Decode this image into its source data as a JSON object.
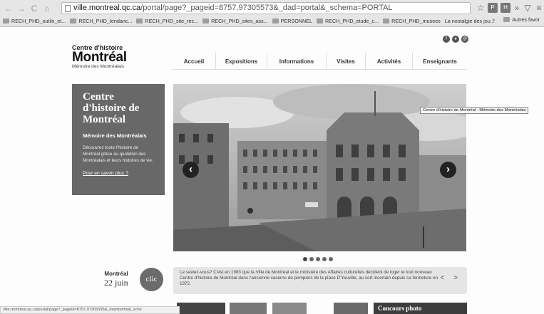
{
  "browser": {
    "url_host": "ville.montreal.qc.ca",
    "url_path": "/portal/page?_pageid=8757,97305573&_dad=portal&_schema=PORTAL",
    "bookmarks": [
      "RECH_PHD_outils_et...",
      "RECH_PHD_tendanc...",
      "RECH_PHD_site_rec...",
      "RECH_PHD_sites_ass...",
      "PERSONNEL",
      "RECH_PHD_etude_c...",
      "RECH_PHD_musees",
      "La nostalgie des jou..."
    ],
    "bookmarks_overflow": "»",
    "other_bookmarks": "Autres favor"
  },
  "site": {
    "logo_line1": "Centre d'histoire",
    "logo_line2": "Montréal",
    "logo_line3": "Mémoire des Montréalais",
    "nav": [
      "Accueil",
      "Expositions",
      "Informations",
      "Visites",
      "Activités",
      "Enseignants"
    ]
  },
  "hero": {
    "title": "Centre d'histoire de Montréal",
    "subtitle": "Mémoire des Montréalais",
    "description": "Découvrez toute l'histoire de Montréal grâce au quotidien des Montréalais et leurs histoires de vie.",
    "more_link": "Pour en savoir plus ?",
    "tooltip": "Centre d'histoire de Montréal - Mémoire des Montréalais",
    "prev_icon": "‹",
    "next_icon": "›"
  },
  "slider": {
    "count": 5,
    "active": 1
  },
  "fact": {
    "city": "Montréal",
    "date": "22 juin",
    "clic_label": "clic",
    "text": "Le saviez-vous? C'est en 1983 que la Ville de Montréal et le ministère des Affaires culturelles décident de loger le tout nouveau Centre d'histoire de Montréal dans l'ancienne caserne de pompiers de la place D'Youville, au sort incertain depuis sa fermeture en 1972.",
    "nav_label": "< >"
  },
  "status_bar": "ville.montreal.qc.ca/portal/page?_pageid=8757,97305595&_dad=portal&_sche",
  "promo_title": "Concours photo"
}
